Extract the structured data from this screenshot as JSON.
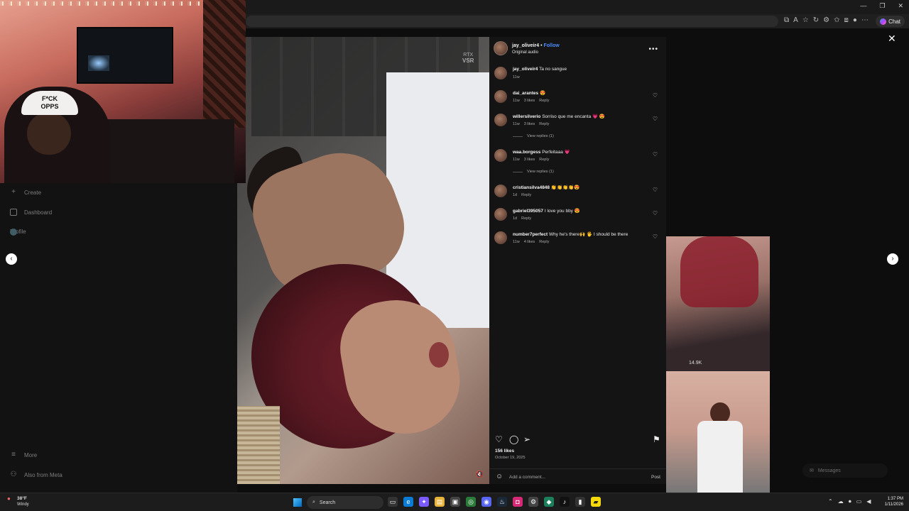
{
  "sidebar": {
    "items": [
      {
        "label": "Create",
        "icon": "plus-icon"
      },
      {
        "label": "Dashboard",
        "icon": "dashboard-icon"
      },
      {
        "label": "Profile",
        "icon": "avatar"
      },
      {
        "label": "More",
        "icon": "menu-icon"
      },
      {
        "label": "Also from Meta",
        "icon": "meta-icon"
      }
    ]
  },
  "browser": {
    "copilot_label": "Chat"
  },
  "media": {
    "watermark_line1": "RTX",
    "watermark_line2": "VSR"
  },
  "post": {
    "author": "jay_oliveir4",
    "separator": "•",
    "follow_label": "Follow",
    "audio": "Original audio",
    "more": "•••",
    "caption": {
      "user": "jay_oliveir4",
      "text": "Ta no sangue",
      "time": "11w"
    },
    "comments": [
      {
        "user": "dai_arantes",
        "text": "😍",
        "time": "11w",
        "likes": "3 likes",
        "reply": "Reply"
      },
      {
        "user": "willersilverio",
        "text": "Sorriso que me encanta 💗 😍",
        "time": "11w",
        "likes": "3 likes",
        "reply": "Reply",
        "view_replies": "View replies (1)"
      },
      {
        "user": "waa.borgess",
        "text": "Perfeitaaa 💗",
        "time": "11w",
        "likes": "3 likes",
        "reply": "Reply",
        "view_replies": "View replies (1)"
      },
      {
        "user": "cristiansilva4848",
        "text": "👏👏👏👏😍",
        "time": "1d",
        "likes": "",
        "reply": "Reply"
      },
      {
        "user": "gabriel395057",
        "text": "I love you bby 😍",
        "time": "1d",
        "likes": "",
        "reply": "Reply"
      },
      {
        "user": "number7perfect",
        "text": "Why he's there🙌 🖐 I should be there",
        "time": "11w",
        "likes": "4 likes",
        "reply": "Reply"
      }
    ],
    "likes": "156 likes",
    "date": "October 19, 2025",
    "add_comment_placeholder": "Add a comment...",
    "post_label": "Post"
  },
  "suggested": {
    "views": "14.9K"
  },
  "messages_label": "Messages",
  "taskbar": {
    "temp": "38°F",
    "condition": "Windy",
    "search_label": "Search",
    "time": "1:37 PM",
    "date": "1/11/2026"
  }
}
